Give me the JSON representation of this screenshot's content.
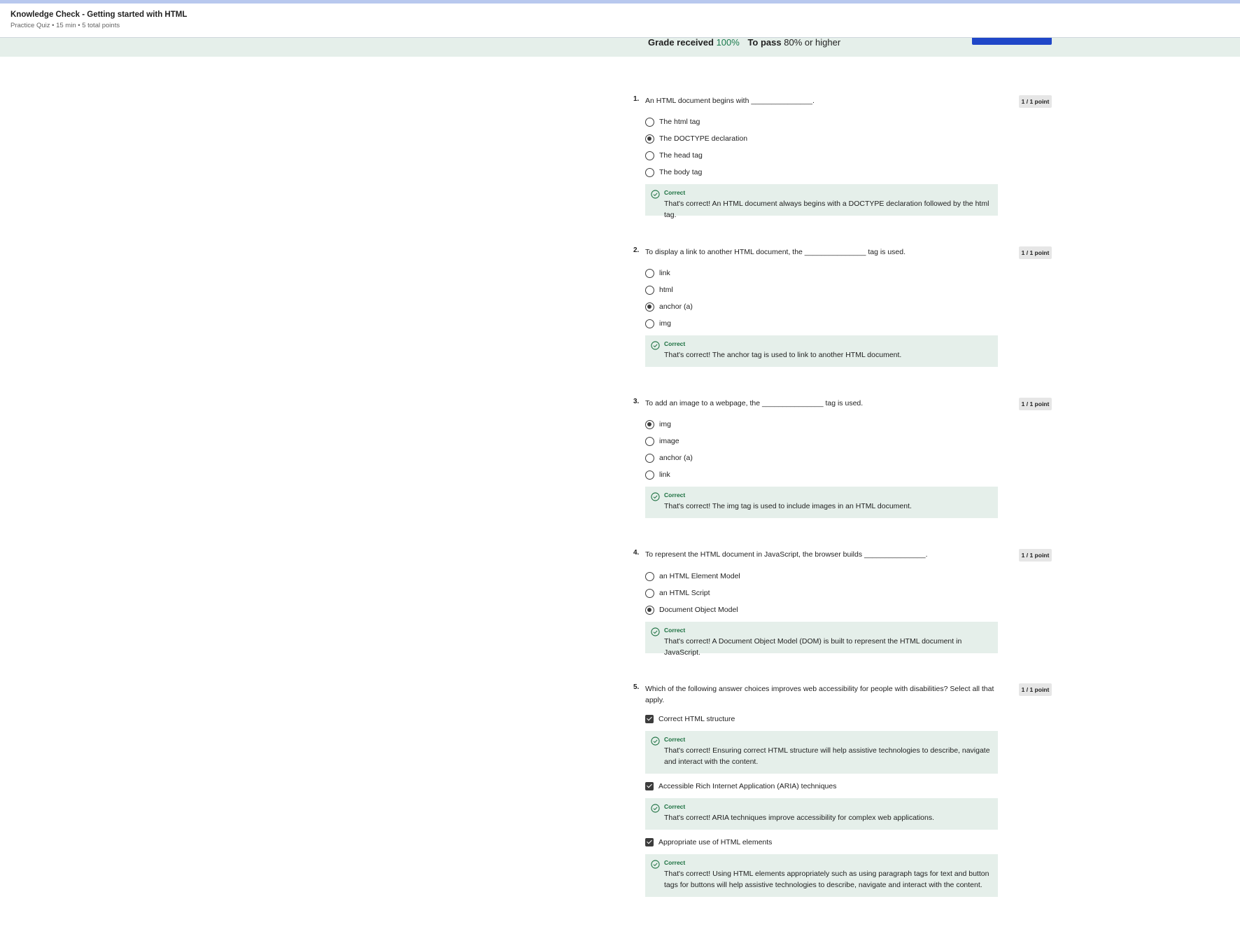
{
  "header": {
    "title": "Knowledge Check - Getting started with HTML",
    "meta": "Practice Quiz • 15 min • 5 total points"
  },
  "grade": {
    "received_label": "Grade received",
    "received_value": "100%",
    "pass_label": "To pass",
    "pass_value": "80% or higher"
  },
  "colors": {
    "accent": "#1f47c8",
    "correct": "#1a6f3f",
    "feedback_bg": "#e5efea"
  },
  "questions": [
    {
      "number": "1.",
      "text": "An HTML document begins with _______________.",
      "points": "1 / 1 point",
      "type": "radio",
      "options": [
        {
          "label": "The html tag",
          "selected": false
        },
        {
          "label": "The DOCTYPE declaration",
          "selected": true
        },
        {
          "label": "The head tag",
          "selected": false
        },
        {
          "label": "The body tag",
          "selected": false
        }
      ],
      "feedback": {
        "title": "Correct",
        "text": "That's correct! An HTML document always begins with a DOCTYPE declaration followed by the html tag."
      }
    },
    {
      "number": "2.",
      "text": "To display a link to another HTML document, the _______________ tag is used.",
      "points": "1 / 1 point",
      "type": "radio",
      "options": [
        {
          "label": "link",
          "selected": false
        },
        {
          "label": "html",
          "selected": false
        },
        {
          "label": "anchor (a)",
          "selected": true
        },
        {
          "label": "img",
          "selected": false
        }
      ],
      "feedback": {
        "title": "Correct",
        "text": "That's correct! The anchor tag is used to link to another HTML document."
      }
    },
    {
      "number": "3.",
      "text": "To add an image to a webpage, the _______________ tag is used.",
      "points": "1 / 1 point",
      "type": "radio",
      "options": [
        {
          "label": "img",
          "selected": true
        },
        {
          "label": "image",
          "selected": false
        },
        {
          "label": "anchor (a)",
          "selected": false
        },
        {
          "label": "link",
          "selected": false
        }
      ],
      "feedback": {
        "title": "Correct",
        "text": "That's correct! The img tag is used to include images in an HTML document."
      }
    },
    {
      "number": "4.",
      "text": "To represent the HTML document in JavaScript, the browser builds  _______________.",
      "points": "1 / 1 point",
      "type": "radio",
      "options": [
        {
          "label": "an HTML Element Model",
          "selected": false
        },
        {
          "label": "an HTML Script",
          "selected": false
        },
        {
          "label": "Document Object Model",
          "selected": true
        }
      ],
      "feedback": {
        "title": "Correct",
        "text": "That's correct! A Document Object Model (DOM) is built to represent the HTML document in JavaScript."
      }
    },
    {
      "number": "5.",
      "text": "Which of the following answer choices improves web accessibility for people with disabilities? Select all that apply.",
      "points": "1 / 1 point",
      "type": "checkbox",
      "options": [
        {
          "label": "Correct HTML structure",
          "selected": true,
          "feedback": {
            "title": "Correct",
            "text": "That's correct! Ensuring correct HTML structure will help assistive technologies to describe, navigate and interact with the content."
          }
        },
        {
          "label": "Accessible Rich Internet Application (ARIA) techniques",
          "selected": true,
          "feedback": {
            "title": "Correct",
            "text": "That's correct! ARIA techniques improve accessibility for complex web applications."
          }
        },
        {
          "label": "Appropriate use of HTML elements",
          "selected": true,
          "feedback": {
            "title": "Correct",
            "text": "That's correct! Using HTML elements appropriately such as using paragraph tags for text and button tags for buttons will help assistive technologies to describe, navigate and interact with the content."
          }
        }
      ]
    }
  ]
}
